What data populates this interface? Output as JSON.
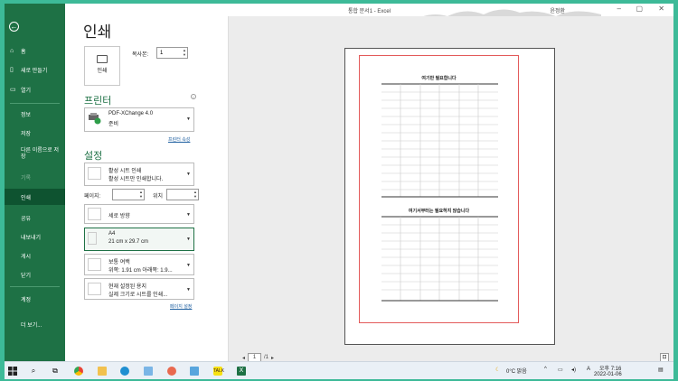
{
  "window": {
    "title": "통합 문서1 - Excel",
    "user": "윤정환"
  },
  "sidebar": {
    "items": [
      {
        "label": "홈",
        "icon": "home-icon"
      },
      {
        "label": "새로 만들기",
        "icon": "new-document-icon"
      },
      {
        "label": "열기",
        "icon": "folder-open-icon"
      },
      {
        "label": "정보"
      },
      {
        "label": "저장"
      },
      {
        "label": "다른 이름으로 저장"
      },
      {
        "label": "기록"
      },
      {
        "label": "인쇄"
      },
      {
        "label": "공유"
      },
      {
        "label": "내보내기"
      },
      {
        "label": "게시"
      },
      {
        "label": "닫기"
      },
      {
        "label": "계정"
      },
      {
        "label": "더 보기..."
      }
    ]
  },
  "print": {
    "heading": "인쇄",
    "print_button": "인쇄",
    "copies_label": "복사본:",
    "copies_value": "1",
    "printer_heading": "프린터",
    "printer_name": "PDF-XChange 4.0",
    "printer_status": "준비",
    "printer_props_link": "프린터 속성",
    "settings_heading": "설정",
    "scope": {
      "title": "활성 시트 인쇄",
      "sub": "활성 시트만 인쇄합니다."
    },
    "pages_label": "페이지:",
    "to_label": "위치",
    "orientation": "세로 방향",
    "paper": {
      "title": "A4",
      "sub": "21 cm x 29.7 cm"
    },
    "margins": {
      "title": "보통 여백",
      "sub": "위쪽: 1.91 cm 아래쪽: 1.9..."
    },
    "scaling": {
      "title": "현재 설정된 용지",
      "sub": "실제 크기로 시트를 인쇄..."
    },
    "page_setup_link": "페이지 설정"
  },
  "preview": {
    "sheet_title_1": "여기만 필요합니다",
    "sheet_title_2": "여기서부터는 필요하지 않습니다",
    "page_current": "1",
    "page_total": "/1"
  },
  "taskbar": {
    "weather": "0°C 맑음",
    "time": "오후 7:16",
    "date": "2022-01-06",
    "accent": "#3dba98"
  }
}
